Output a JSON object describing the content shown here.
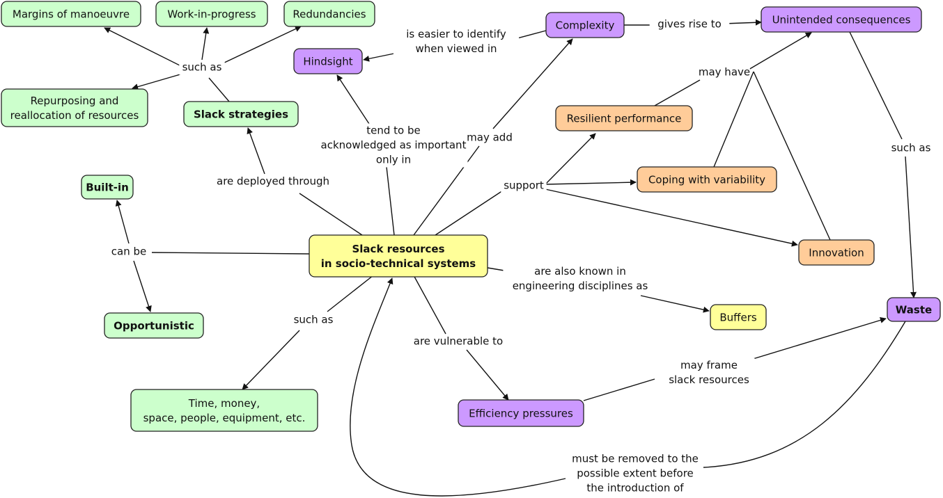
{
  "colors": {
    "green": "#ccffcc",
    "purple": "#cc99ff",
    "orange": "#ffcc99",
    "yellow": "#ffff99",
    "line": "#111111"
  },
  "nodes": {
    "margins": {
      "lines": [
        "Margins of manoeuvre"
      ],
      "color": "green",
      "bold": false
    },
    "wip": {
      "lines": [
        "Work-in-progress"
      ],
      "color": "green",
      "bold": false
    },
    "redundancies": {
      "lines": [
        "Redundancies"
      ],
      "color": "green",
      "bold": false
    },
    "repurposing": {
      "lines": [
        "Repurposing and",
        "reallocation of resources"
      ],
      "color": "green",
      "bold": false
    },
    "slack_strategies": {
      "lines": [
        "Slack strategies"
      ],
      "color": "green",
      "bold": true
    },
    "hindsight": {
      "lines": [
        "Hindsight"
      ],
      "color": "purple",
      "bold": false
    },
    "complexity": {
      "lines": [
        "Complexity"
      ],
      "color": "purple",
      "bold": false
    },
    "unintended": {
      "lines": [
        "Unintended consequences"
      ],
      "color": "purple",
      "bold": false
    },
    "resilient": {
      "lines": [
        "Resilient performance"
      ],
      "color": "orange",
      "bold": false
    },
    "coping": {
      "lines": [
        "Coping with variability"
      ],
      "color": "orange",
      "bold": false
    },
    "innovation": {
      "lines": [
        "Innovation"
      ],
      "color": "orange",
      "bold": false
    },
    "builtin": {
      "lines": [
        "Built-in"
      ],
      "color": "green",
      "bold": true
    },
    "opportunistic": {
      "lines": [
        "Opportunistic"
      ],
      "color": "green",
      "bold": true
    },
    "central": {
      "lines": [
        "Slack resources",
        "in socio-technical systems"
      ],
      "color": "yellow",
      "bold": true
    },
    "buffers": {
      "lines": [
        "Buffers"
      ],
      "color": "yellow",
      "bold": false
    },
    "waste": {
      "lines": [
        "Waste"
      ],
      "color": "purple",
      "bold": true
    },
    "time": {
      "lines": [
        "Time, money,",
        "space, people, equipment, etc."
      ],
      "color": "green",
      "bold": false
    },
    "efficiency": {
      "lines": [
        "Efficiency pressures"
      ],
      "color": "purple",
      "bold": false
    }
  },
  "links": {
    "such_as_strategies": [
      "such as"
    ],
    "easier_identify": [
      "is easier to identify",
      "when viewed in"
    ],
    "gives_rise": [
      "gives rise to"
    ],
    "may_have": [
      "may have"
    ],
    "tend_to_be": [
      "tend to be",
      "acknowledged as important",
      "only in"
    ],
    "may_add": [
      "may add"
    ],
    "such_as_unintended": [
      "such as"
    ],
    "deployed_through": [
      "are deployed through"
    ],
    "support": [
      "support"
    ],
    "can_be": [
      "can be"
    ],
    "also_known": [
      "are also known in",
      "engineering disciplines as"
    ],
    "such_as_time": [
      "such as"
    ],
    "vulnerable": [
      "are vulnerable to"
    ],
    "may_frame": [
      "may frame",
      "slack resources"
    ],
    "must_be_removed": [
      "must be removed to the",
      "possible extent before",
      "the introduction of"
    ]
  }
}
